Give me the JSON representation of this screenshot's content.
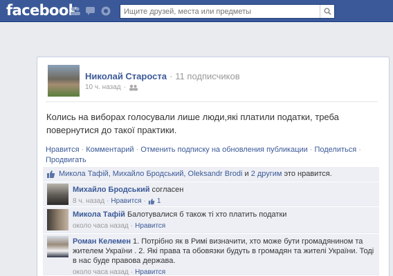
{
  "header": {
    "logo": "facebook",
    "search_placeholder": "Ищите друзей, места или предметы",
    "icons": [
      "friend-requests-icon",
      "messages-icon",
      "notifications-icon",
      "search-icon"
    ]
  },
  "post": {
    "author": "Николай Староста",
    "separator": "·",
    "subscribers": "11 подписчиков",
    "time": "10 ч. назад",
    "text": "Колись на виборах голосували лише люди,які платили податки, треба повернутися до такої практики.",
    "actions": {
      "like": "Нравится",
      "comment": "Комментарий",
      "unsubscribe": "Отменить подписку на обновления публикации",
      "share": "Поделиться",
      "promote": "Продвигать",
      "dot": "·"
    }
  },
  "likes": {
    "names": "Микола Тафій, Михайло Бродський, Oleksandr Brodi",
    "and": " и ",
    "others": "2 другим",
    "suffix": " это нравится."
  },
  "comments": [
    {
      "author": "Михайло Бродський",
      "text": " согласен",
      "time": "8 ч. назад",
      "like": "Нравится",
      "likes_count": "1",
      "dot": "·"
    },
    {
      "author": "Микола Тафій",
      "text": " Балотувалися б також ті хто платить податки",
      "time": "около часа назад",
      "like": "Нравится",
      "dot": "·"
    },
    {
      "author": "Роман Келемен",
      "text": " 1. Потрібно як в Римі визначити, хто може бути громадянином та жителем України . 2. Які права та обовязки будуть в громадян та жителі України. Тоді в нас буде правова держава.",
      "time": "около часа назад",
      "like": "Нравится",
      "dot": "·"
    }
  ],
  "colors": {
    "brand": "#3b5998",
    "background": "#e9ebee",
    "comment_bg": "#edeff4",
    "link": "#3b5998"
  }
}
